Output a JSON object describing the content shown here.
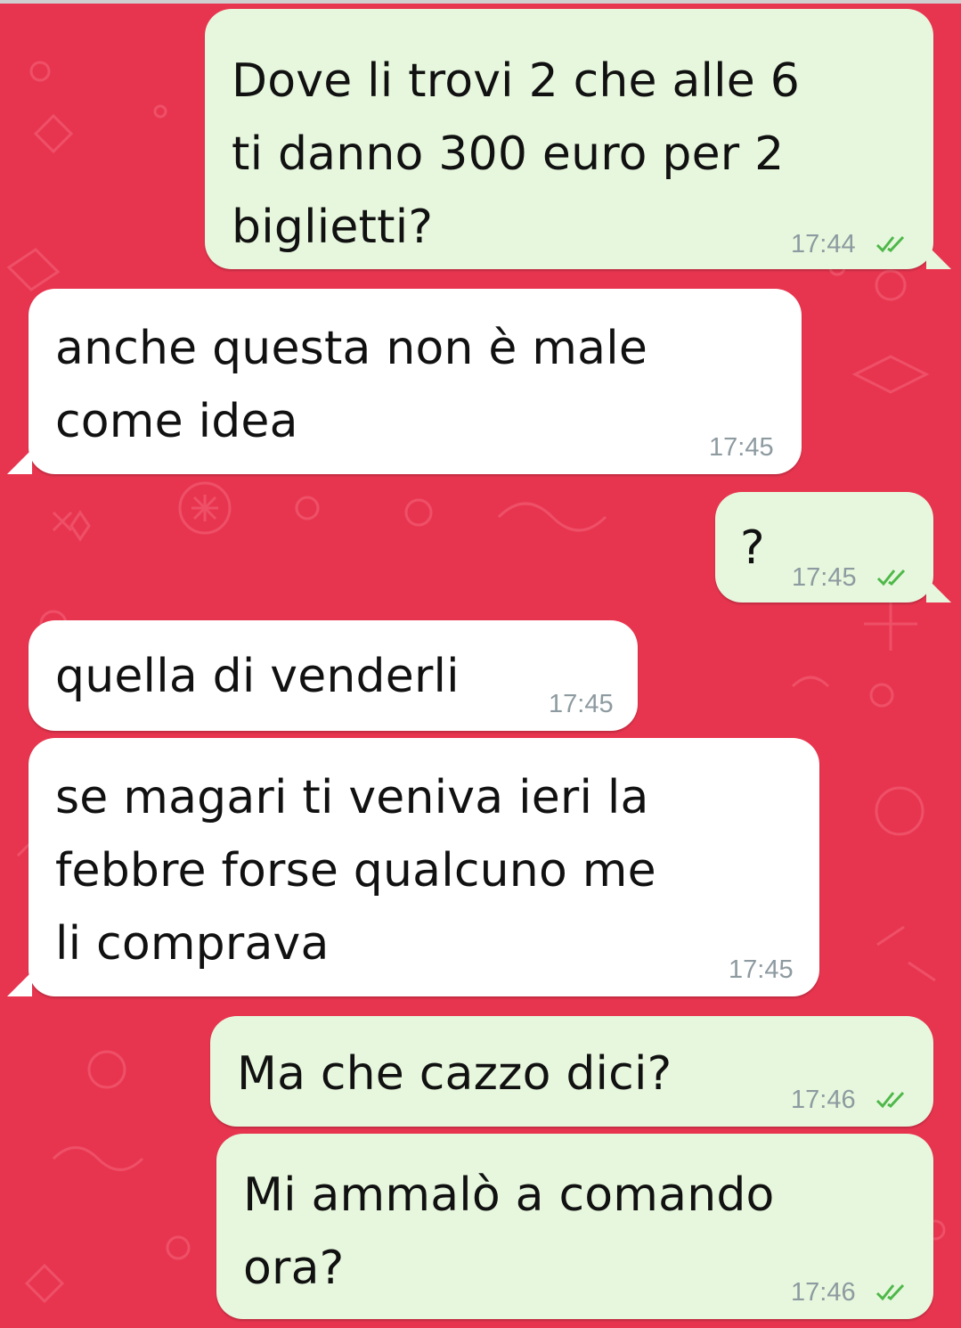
{
  "chat": {
    "colors": {
      "background": "#e8354f",
      "outgoing": "#e6f7dd",
      "incoming": "#ffffff",
      "read_ticks": "#4fb84a",
      "time": "#8d9aa0"
    },
    "messages": [
      {
        "direction": "outgoing",
        "text": "Dove li trovi 2 che alle 6\nti danno 300 euro per 2\nbiglietti?",
        "time": "17:44",
        "status": "read",
        "status_icon": "double-check-icon"
      },
      {
        "direction": "incoming",
        "text": "anche questa non è male\ncome idea",
        "time": "17:45"
      },
      {
        "direction": "outgoing",
        "text": "?",
        "time": "17:45",
        "status": "read",
        "status_icon": "double-check-icon"
      },
      {
        "direction": "incoming",
        "text": "quella di venderli",
        "time": "17:45"
      },
      {
        "direction": "incoming",
        "text": "se magari ti veniva ieri la\nfebbre forse qualcuno me\nli comprava",
        "time": "17:45"
      },
      {
        "direction": "outgoing",
        "text": "Ma che cazzo dici?",
        "time": "17:46",
        "status": "read",
        "status_icon": "double-check-icon"
      },
      {
        "direction": "outgoing",
        "text": "Mi ammalò a comando\nora?",
        "time": "17:46",
        "status": "read",
        "status_icon": "double-check-icon"
      }
    ]
  }
}
